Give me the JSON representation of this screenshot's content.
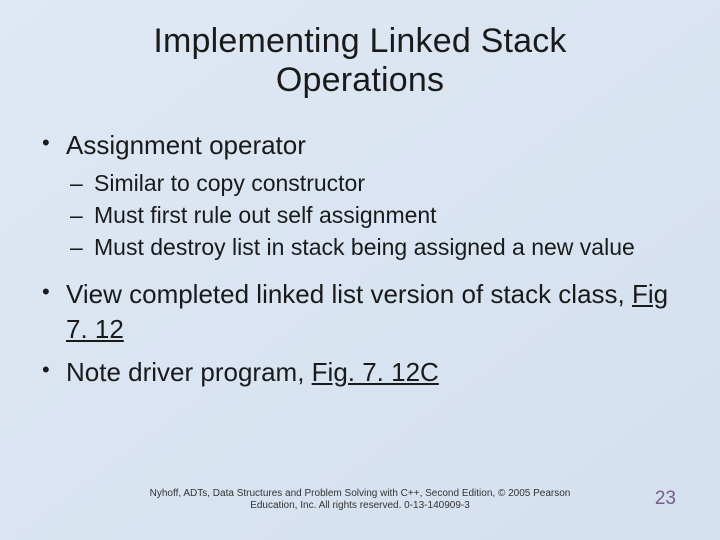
{
  "title_line1": "Implementing Linked Stack",
  "title_line2": "Operations",
  "bullets": {
    "b1": "Assignment operator",
    "b1_sub": {
      "s1": "Similar to copy constructor",
      "s2": "Must first rule out self assignment",
      "s3": "Must destroy list in stack being assigned a new value"
    },
    "b2a": "View completed linked list version of stack class, ",
    "b2_link": "Fig 7. 12",
    "b3a": "Note driver program, ",
    "b3_link": "Fig. 7. 12C"
  },
  "footer_line1": "Nyhoff, ADTs, Data Structures and Problem Solving with C++, Second Edition, © 2005 Pearson",
  "footer_line2": "Education, Inc. All rights reserved. 0-13-140909-3",
  "page_number": "23"
}
